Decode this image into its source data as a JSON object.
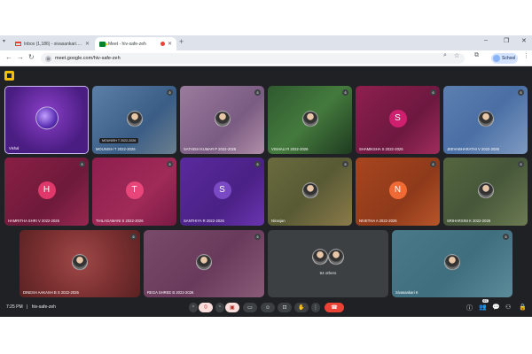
{
  "browser": {
    "tabs": [
      {
        "title": "Inbox (1,186) - sivasankari.rockinmynet.com - Gmail",
        "active": false
      },
      {
        "title": "Meet - hiv-safe-zeh",
        "active": true
      }
    ],
    "url": "meet.google.com/hiv-safe-zeh",
    "profile_label": "School"
  },
  "meeting": {
    "tiles_row1": [
      {
        "name": "Vishal",
        "kind": "presenter"
      },
      {
        "name": "MOUNISH T 2022-2026",
        "kind": "photo",
        "tooltip": "MOUNISH T 2022-2026"
      },
      {
        "name": "SATHISH KUMAR P 2022-2026",
        "kind": "photo"
      },
      {
        "name": "VISHALI R 2022-2026",
        "kind": "photo"
      },
      {
        "name": "SHAMIKSHA S 2022-2026",
        "kind": "letter",
        "letter": "S"
      },
      {
        "name": "JEEVABHARATHI V 2022-2026",
        "kind": "photo"
      }
    ],
    "tiles_row2": [
      {
        "name": "HAMRITHA SHRI V 2022-2026",
        "kind": "letter",
        "letter": "H"
      },
      {
        "name": "THILAGAMANI S 2022-2026",
        "kind": "letter",
        "letter": "T"
      },
      {
        "name": "SANTHIYA R 2022-2026",
        "kind": "letter",
        "letter": "S"
      },
      {
        "name": "Niranjan",
        "kind": "photo"
      },
      {
        "name": "NIVETHA A 2022-2026",
        "kind": "letter",
        "letter": "N"
      },
      {
        "name": "SRIHARSINI K 2022-2026",
        "kind": "photo"
      }
    ],
    "tiles_row3": [
      {
        "name": "DINESH AAKASH B S 2022-2026",
        "kind": "photo"
      },
      {
        "name": "REGA SHREE B 2022-2026",
        "kind": "photo"
      },
      {
        "name": "",
        "kind": "others",
        "others_label": "64 others"
      },
      {
        "name": "Sivasankari K",
        "kind": "photo"
      }
    ],
    "time": "7:25 PM",
    "separator": "|",
    "code": "hiv-safe-zeh",
    "participant_count": "67"
  },
  "colors": {
    "meet_bg": "#202124",
    "end_call": "#ea4335",
    "muted_control": "#f9dedc"
  }
}
